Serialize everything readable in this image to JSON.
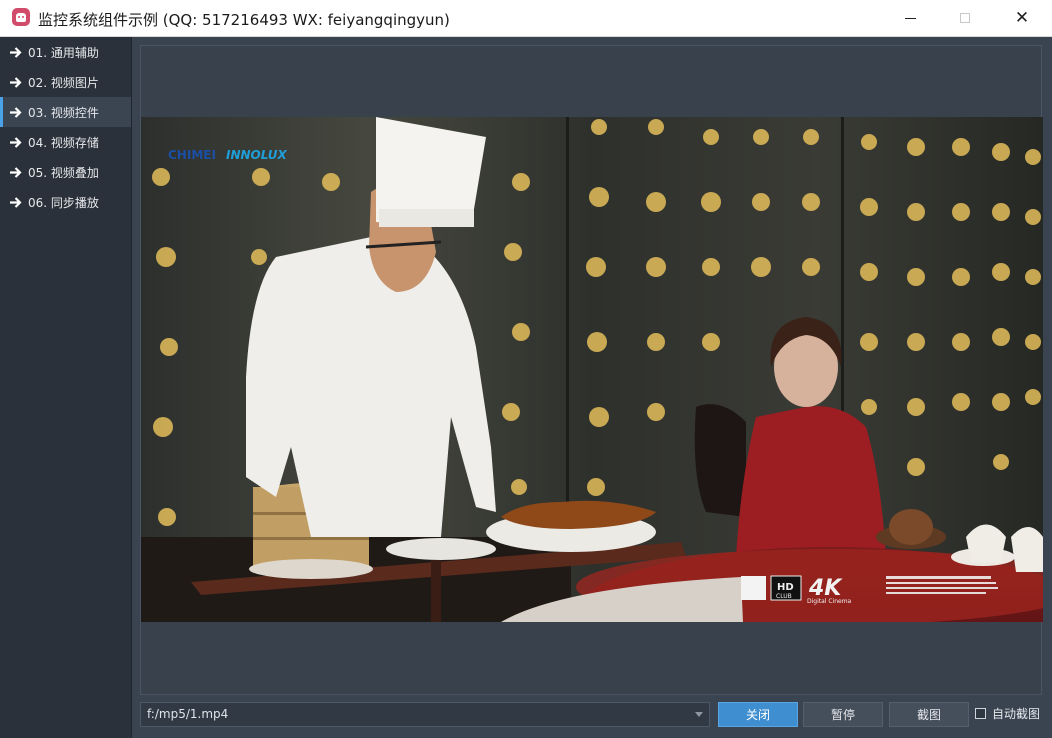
{
  "window": {
    "title": "监控系统组件示例 (QQ: 517216493  WX: feiyangqingyun)",
    "minimize": "minimize",
    "maximize": "maximize",
    "close": "close"
  },
  "sidebar": {
    "items": [
      {
        "label": "01. 通用辅助",
        "active": false
      },
      {
        "label": "02. 视频图片",
        "active": false
      },
      {
        "label": "03. 视频控件",
        "active": true
      },
      {
        "label": "04. 视频存储",
        "active": false
      },
      {
        "label": "05. 视频叠加",
        "active": false
      },
      {
        "label": "06. 同步播放",
        "active": false
      }
    ]
  },
  "video": {
    "logo_brand_a": "CHIMEI",
    "logo_brand_b": "INNOLUX",
    "hd_badge": "HD",
    "hd_sub": "CLUB",
    "fourk": "4K",
    "fourk_sub": "Digital Cinema"
  },
  "controls": {
    "path": "f:/mp5/1.mp4",
    "close_label": "关闭",
    "pause_label": "暂停",
    "snapshot_label": "截图",
    "auto_snapshot_label": "自动截图"
  },
  "colors": {
    "accent": "#3f8fd0",
    "sidebar_bg": "#2a313a",
    "main_bg": "#3a4350"
  }
}
